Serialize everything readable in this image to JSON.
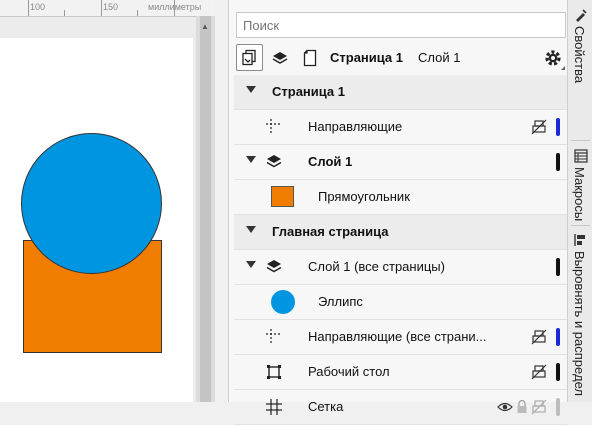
{
  "ruler": {
    "labels": [
      "100",
      "150",
      "миллиметры"
    ]
  },
  "panel": {
    "search_placeholder": "Поиск",
    "toolbar": {
      "page_label": "Страница 1",
      "layer_label": "Слой 1"
    },
    "rows": {
      "r0": "Страница 1",
      "r1": "Направляющие",
      "r2": "Слой 1",
      "r3": "Прямоугольник",
      "r4": "Главная страница",
      "r5": "Слой 1 (все страницы)",
      "r6": "Эллипс",
      "r7": "Направляющие (все страни...",
      "r8": "Рабочий стол",
      "r9": "Сетка"
    }
  },
  "dock": {
    "tab1": "Свойства",
    "tab2": "Макросы",
    "tab3": "Выровнять и распредел"
  },
  "colors": {
    "rectangle_fill": "#f07c00",
    "ellipse_fill": "#0095e0",
    "guides_bar": "#1a2bd6",
    "layer_bar": "#111111"
  }
}
